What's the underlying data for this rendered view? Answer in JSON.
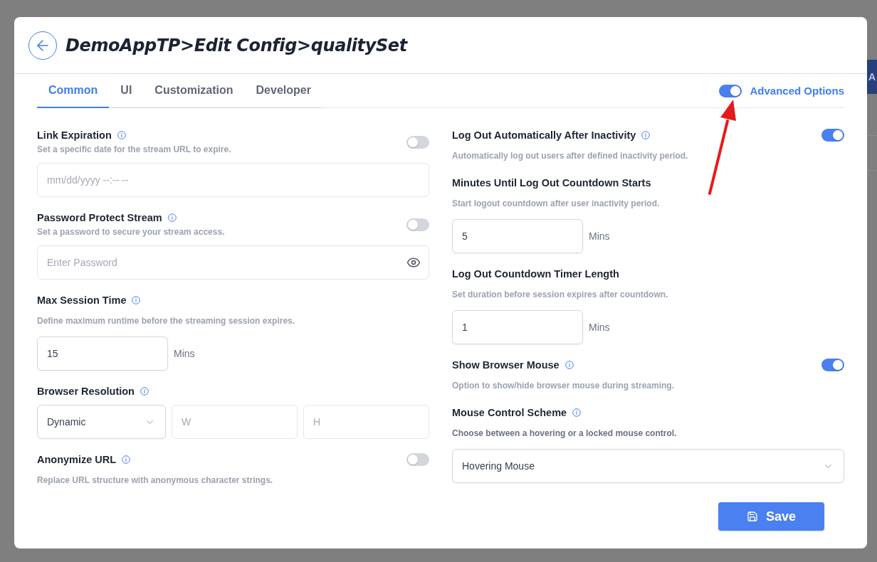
{
  "header": {
    "title": "DemoAppTP>Edit Config>qualitySet"
  },
  "tabs": [
    {
      "label": "Common",
      "selected": true
    },
    {
      "label": "UI",
      "selected": false
    },
    {
      "label": "Customization",
      "selected": false
    },
    {
      "label": "Developer",
      "selected": false
    }
  ],
  "advanced_options": {
    "label": "Advanced Options",
    "on": true
  },
  "left_column": [
    {
      "title": "Link Expiration",
      "info_icon": true,
      "toggle": {
        "on": false
      },
      "description": "Set a specific date for the stream URL to expire.",
      "description_muted": true,
      "field": {
        "kind": "datetime",
        "placeholder": "mm/dd/yyyy --:-- --"
      }
    },
    {
      "title": "Password Protect Stream",
      "info_icon": true,
      "toggle": {
        "on": false
      },
      "description": "Set a password to secure your stream access.",
      "description_muted": true,
      "field": {
        "kind": "password",
        "placeholder": "Enter Password"
      }
    },
    {
      "title": "Max Session Time",
      "info_icon": true,
      "description": "Define maximum runtime before the streaming session expires.",
      "description_muted": true,
      "field": {
        "kind": "number",
        "value": "15",
        "unit": "Mins"
      }
    },
    {
      "title": "Browser Resolution",
      "info_icon": true,
      "field": {
        "kind": "resolution",
        "value": "Dynamic",
        "width_placeholder": "W",
        "height_placeholder": "H"
      }
    },
    {
      "title": "Anonymize URL",
      "info_icon": true,
      "toggle": {
        "on": false
      },
      "description": "Replace URL structure with anonymous character strings.",
      "description_muted": true
    }
  ],
  "right_column": [
    {
      "title": "Log Out Automatically After Inactivity",
      "info_icon": true,
      "toggle": {
        "on": true
      },
      "description": "Automatically log out users after defined inactivity period.",
      "description_muted": true
    },
    {
      "title": "Minutes Until Log Out Countdown Starts",
      "info_icon": false,
      "description": "Start logout countdown after user inactivity period.",
      "description_muted": true,
      "field": {
        "kind": "number",
        "value": "5",
        "unit": "Mins"
      }
    },
    {
      "title": "Log Out Countdown Timer Length",
      "info_icon": false,
      "description": "Set duration before session expires after countdown.",
      "description_muted": true,
      "field": {
        "kind": "number",
        "value": "1",
        "unit": "Mins"
      }
    },
    {
      "title": "Show Browser Mouse",
      "info_icon": true,
      "toggle": {
        "on": true
      },
      "description": "Option to show/hide browser mouse during streaming.",
      "description_muted": true
    },
    {
      "title": "Mouse Control Scheme",
      "info_icon": true,
      "description": "Choose between a hovering or a locked mouse control.",
      "description_muted": false,
      "field": {
        "kind": "select",
        "value": "Hovering Mouse"
      }
    }
  ],
  "save_button": {
    "label": "Save"
  },
  "backdrop": {
    "button_label": "A"
  }
}
